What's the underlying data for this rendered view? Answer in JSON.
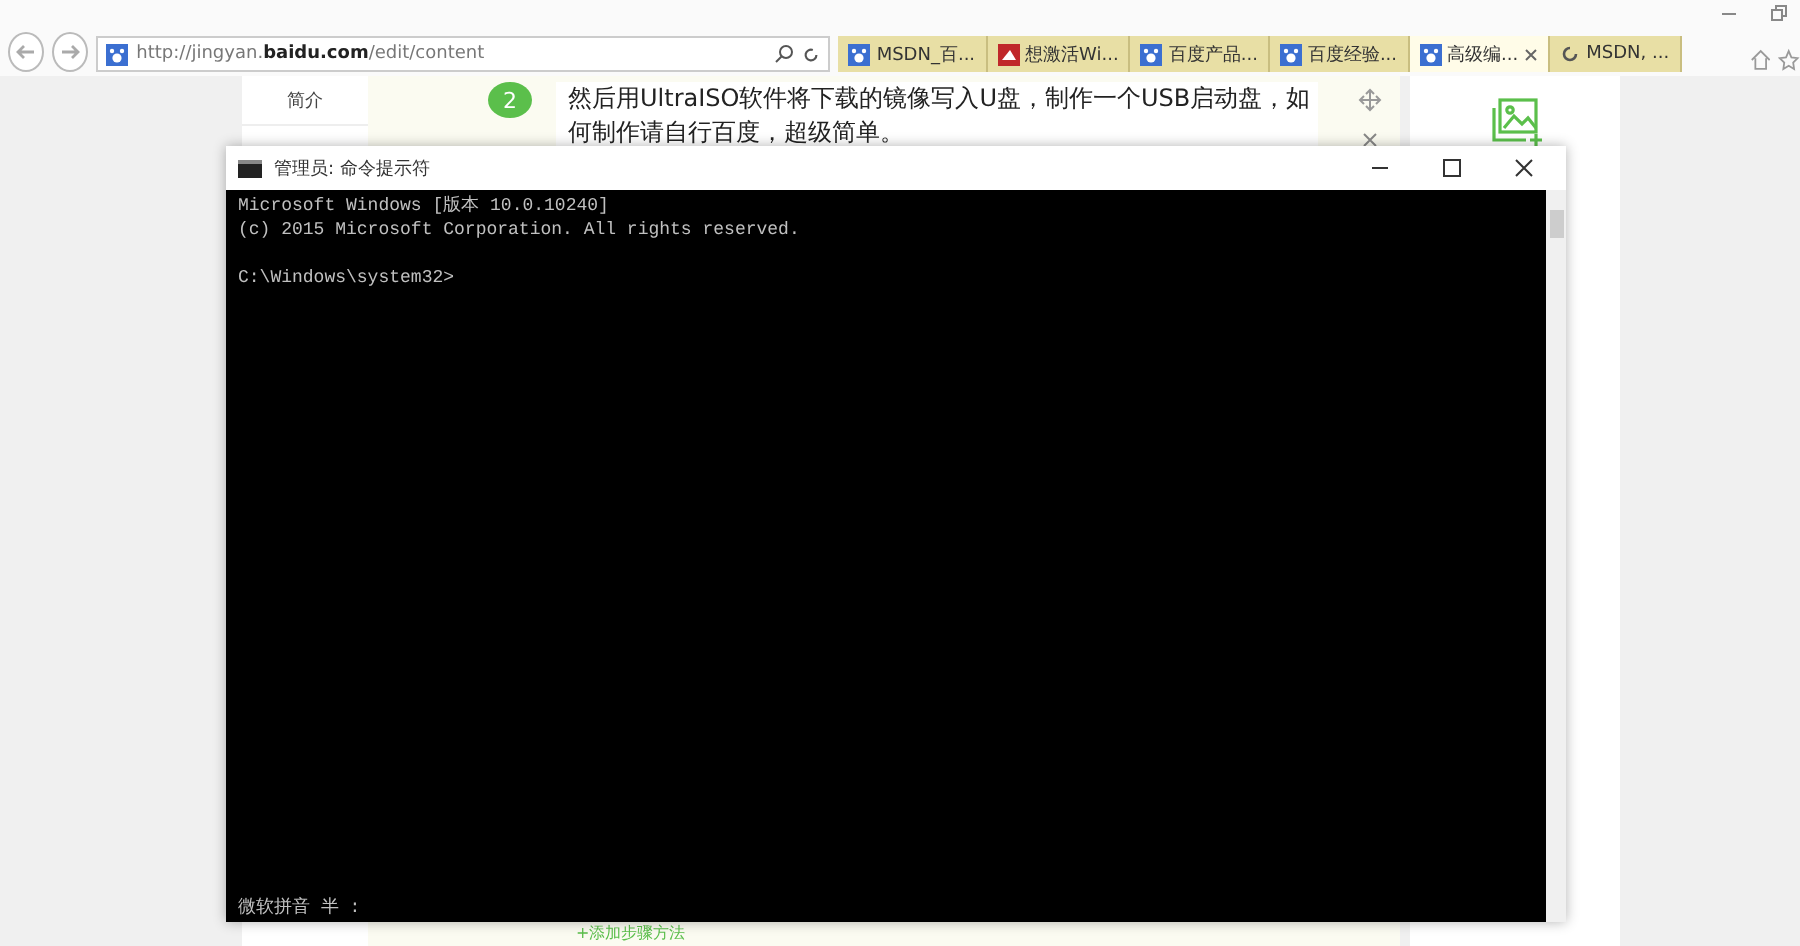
{
  "browser": {
    "address": "http://jingyan.**baidu.com**/edit/content",
    "tabs": [
      {
        "label": "MSDN_百...",
        "selected": false
      },
      {
        "label": "想激活Wi...",
        "selected": false
      },
      {
        "label": "百度产品...",
        "selected": false
      },
      {
        "label": "百度经验...",
        "selected": false
      },
      {
        "label": "高级编...",
        "selected": true
      },
      {
        "label": "MSDN, ...",
        "selected": false
      }
    ]
  },
  "page": {
    "nav": [
      "简介"
    ],
    "step": {
      "number": "2",
      "text": "然后用UltraISO软件将下载的镜像写入U盘，制作一个USB启动盘，如何制作请自行百度，超级简单。"
    },
    "add_step": "+添加步骤方法"
  },
  "console": {
    "title": "管理员: 命令提示符",
    "lines": [
      "Microsoft Windows [版本 10.0.10240]",
      "(c) 2015 Microsoft Corporation. All rights reserved.",
      "C:\\Windows\\system32>"
    ],
    "ime_status": "微软拼音 半 :"
  }
}
